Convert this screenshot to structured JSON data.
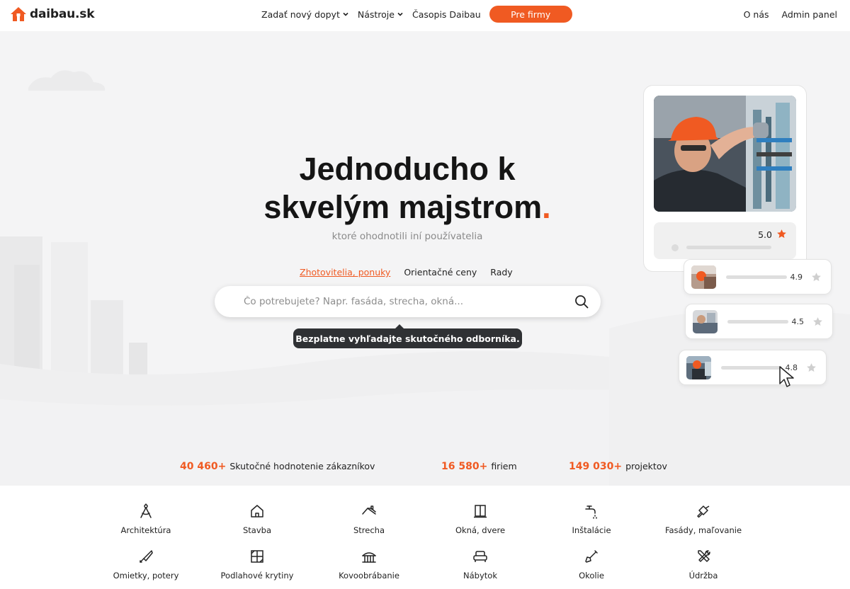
{
  "header": {
    "logo_text": "daibau.sk",
    "nav": [
      {
        "label": "Zadať nový dopyt",
        "has_dropdown": true
      },
      {
        "label": "Nástroje",
        "has_dropdown": true
      },
      {
        "label": "Časopis Daibau",
        "has_dropdown": false
      }
    ],
    "cta_label": "Pre firmy",
    "right_links": [
      "O nás",
      "Admin panel"
    ]
  },
  "hero": {
    "headline_line1": "Jednoducho k",
    "headline_line2": "skvelým majstrom",
    "headline_dot": ".",
    "subheadline": "ktoré ohodnotili iní používatelia",
    "tabs": [
      {
        "label": "Zhotovitelia, ponuky",
        "active": true
      },
      {
        "label": "Orientačné ceny",
        "active": false
      },
      {
        "label": "Rady",
        "active": false
      }
    ],
    "search_placeholder": "Čo potrebujete? Napr. fasáda, strecha, okná...",
    "tooltip": "Bezplatne vyhľadajte skutočného odborníka."
  },
  "reviews": {
    "main_score": "5.0",
    "cards": [
      {
        "score": "4.9"
      },
      {
        "score": "4.5"
      },
      {
        "score": "4.8"
      }
    ]
  },
  "stats": [
    {
      "number": "40 460+",
      "label": "Skutočné hodnotenie zákazníkov"
    },
    {
      "number": "16 580+",
      "label": "firiem"
    },
    {
      "number": "149 030+",
      "label": "projektov"
    }
  ],
  "categories": [
    {
      "label": "Architektúra",
      "icon": "compass-icon"
    },
    {
      "label": "Stavba",
      "icon": "house-icon"
    },
    {
      "label": "Strecha",
      "icon": "roof-icon"
    },
    {
      "label": "Okná, dvere",
      "icon": "window-icon"
    },
    {
      "label": "Inštalácie",
      "icon": "faucet-icon"
    },
    {
      "label": "Fasády, maľovanie",
      "icon": "paint-roller-icon"
    },
    {
      "label": "Omietky, potery",
      "icon": "trowel-icon"
    },
    {
      "label": "Podlahové krytiny",
      "icon": "floor-tiles-icon"
    },
    {
      "label": "Kovoobrábanie",
      "icon": "gate-icon"
    },
    {
      "label": "Nábytok",
      "icon": "sofa-icon"
    },
    {
      "label": "Okolie",
      "icon": "shovel-icon"
    },
    {
      "label": "Údržba",
      "icon": "tools-icon"
    }
  ],
  "colors": {
    "accent": "#f05a22",
    "dark": "#151515",
    "tooltip_bg": "#2f3134",
    "page_bg": "#f4f4f5"
  }
}
